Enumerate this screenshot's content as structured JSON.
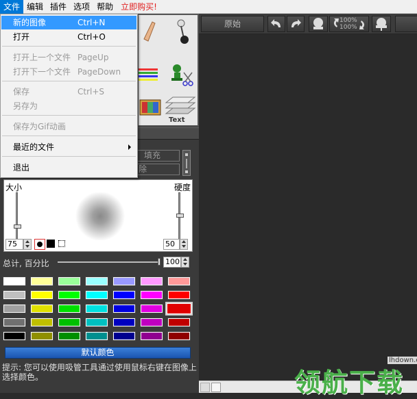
{
  "menubar": {
    "items": [
      "文件",
      "编辑",
      "插件",
      "选项",
      "帮助"
    ],
    "promo": "立即购买!"
  },
  "file_menu": {
    "new_image": {
      "label": "新的图像",
      "shortcut": "Ctrl+N"
    },
    "open": {
      "label": "打开",
      "shortcut": "Ctrl+O"
    },
    "open_prev": {
      "label": "打开上一个文件",
      "shortcut": "PageUp"
    },
    "open_next": {
      "label": "打开下一个文件",
      "shortcut": "PageDown"
    },
    "save": {
      "label": "保存",
      "shortcut": "Ctrl+S"
    },
    "save_as": {
      "label": "另存为"
    },
    "save_gif": {
      "label": "保存为Gif动画"
    },
    "recent": {
      "label": "最近的文件"
    },
    "exit": {
      "label": "退出"
    }
  },
  "fill_panel": {
    "fill_label": "填充",
    "second_label": "除"
  },
  "brush": {
    "size_label": "大小",
    "hardness_label": "硬度",
    "size_value": "75",
    "hardness_value": "50"
  },
  "opacity": {
    "label": "总计, 百分比",
    "value": "100"
  },
  "palette": {
    "rows": [
      [
        "#ffffff",
        "#ffff99",
        "#99ff99",
        "#99ffff",
        "#9999ff",
        "#ff99ff",
        "#ff9999"
      ],
      [
        "#c0c0c0",
        "#ffff00",
        "#00ff00",
        "#00ffff",
        "#0000ff",
        "#ff00ff",
        "#ff0000"
      ],
      [
        "#a0a0a0",
        "#e0e000",
        "#00e000",
        "#00e0e0",
        "#0000e0",
        "#e000e0",
        "#e00000"
      ],
      [
        "#707070",
        "#c0c000",
        "#00c000",
        "#00c0c0",
        "#0000c0",
        "#c000c0",
        "#c00000"
      ],
      [
        "#000000",
        "#909000",
        "#009000",
        "#009090",
        "#000090",
        "#900090",
        "#900000"
      ]
    ],
    "selected_color": "#e00000"
  },
  "default_color_button": "默认颜色",
  "hint": "提示: 您可以使用吸管工具通过使用鼠标右键在图像上选择颜色。",
  "toolbar": {
    "original_label": "原始",
    "zoom_top": "100%",
    "zoom_bottom": "100%"
  },
  "watermark": {
    "site": "lhdown.com",
    "brand": "领航下载"
  },
  "colors": {
    "menu_highlight": "#3399ff",
    "promo": "#e02020",
    "default_btn": "#2a6ac8"
  }
}
